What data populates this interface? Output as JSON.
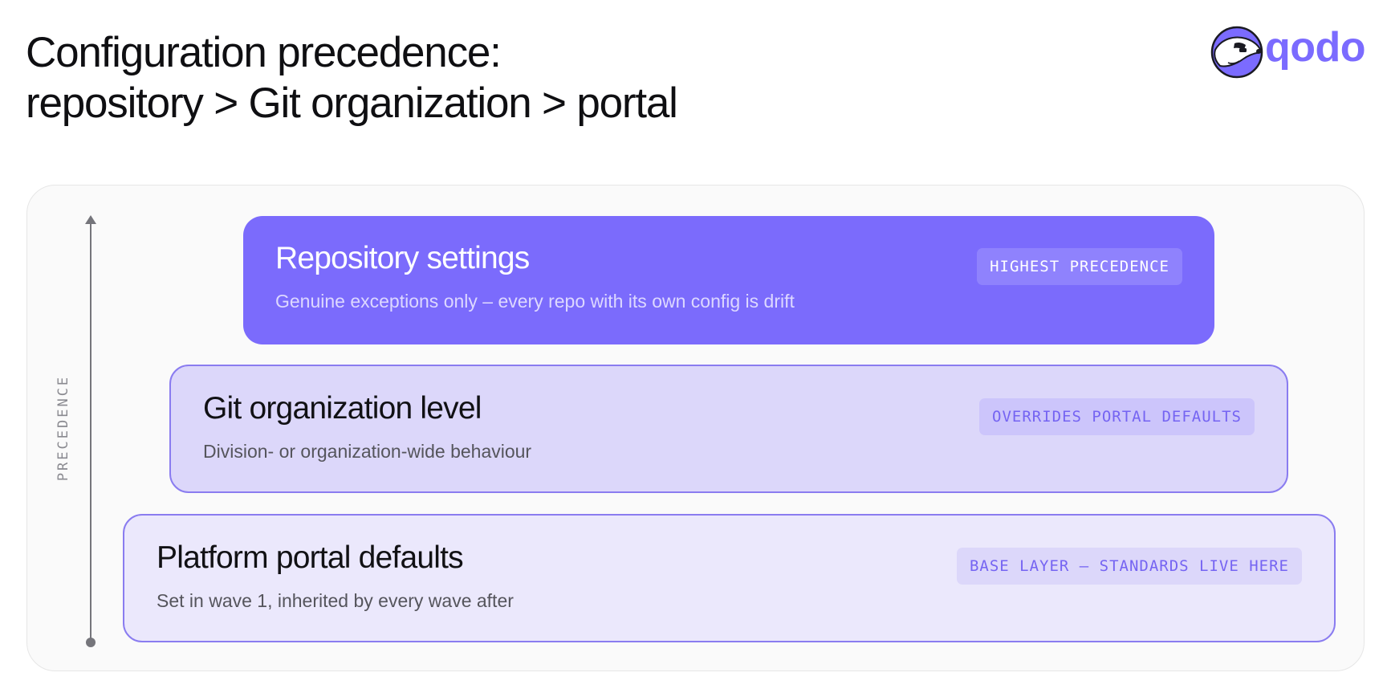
{
  "header": {
    "title_line1": "Configuration precedence:",
    "title_line2": "repository > Git organization > portal"
  },
  "logo": {
    "text": "qodo",
    "icon": "badger-mascot-icon"
  },
  "axis": {
    "label": "PRECEDENCE",
    "direction": "up"
  },
  "layers": [
    {
      "title": "Repository settings",
      "description": "Genuine exceptions only – every repo with its own config is drift",
      "badge": "HIGHEST PRECEDENCE"
    },
    {
      "title": "Git organization level",
      "description": "Division- or organization-wide behaviour",
      "badge": "OVERRIDES PORTAL DEFAULTS"
    },
    {
      "title": "Platform portal defaults",
      "description": "Set in wave 1, inherited by every wave after",
      "badge": "BASE LAYER – STANDARDS LIVE HERE"
    }
  ],
  "colors": {
    "brand": "#7b6bff",
    "layer_top_fill": "#7b6bfc",
    "layer_mid_fill": "#dcd7fa",
    "layer_base_fill": "#ebe8fc",
    "layer_border": "#8a7cf0",
    "axis": "#75757b"
  }
}
